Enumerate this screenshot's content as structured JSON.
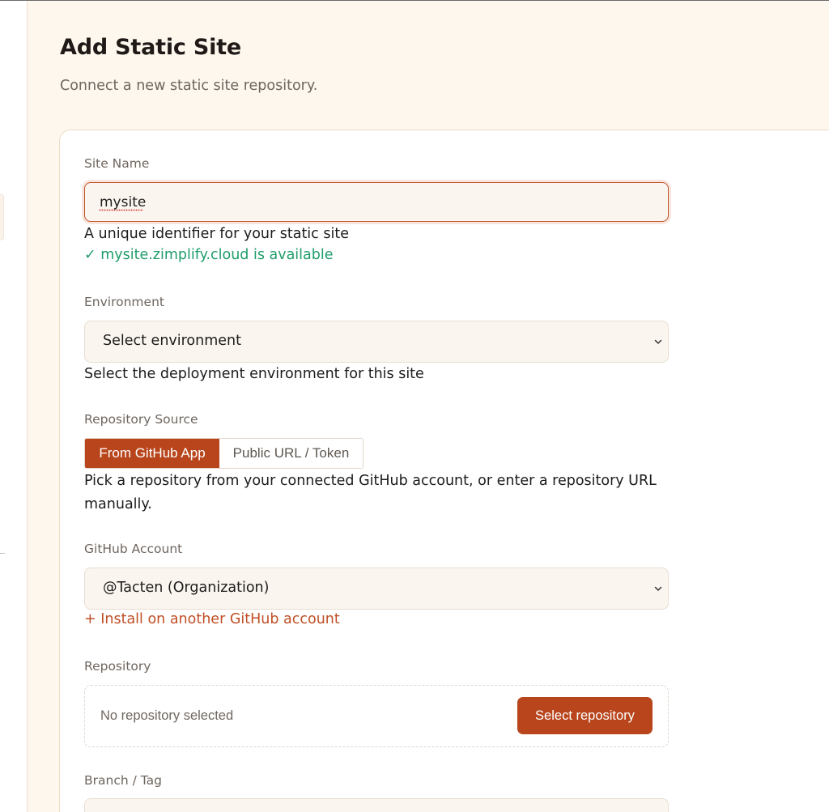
{
  "page": {
    "title": "Add Static Site",
    "subtitle": "Connect a new static site repository."
  },
  "site_name": {
    "label": "Site Name",
    "value": "mysite",
    "help": "A unique identifier for your static site",
    "availability": "✓ mysite.zimplify.cloud is available"
  },
  "environment": {
    "label": "Environment",
    "selected": "Select environment",
    "help": "Select the deployment environment for this site"
  },
  "repository_source": {
    "label": "Repository Source",
    "options": [
      "From GitHub App",
      "Public URL / Token"
    ],
    "selected_index": 0,
    "help": "Pick a repository from your connected GitHub account, or enter a repository URL manually."
  },
  "github_account": {
    "label": "GitHub Account",
    "selected": "@Tacten (Organization)",
    "install_link": "+ Install on another GitHub account"
  },
  "repository": {
    "label": "Repository",
    "empty_text": "No repository selected",
    "button_label": "Select repository"
  },
  "branch": {
    "label": "Branch / Tag"
  },
  "colors": {
    "accent": "#b8451c",
    "success": "#1f9d6b",
    "background": "#fef7ee",
    "field_background": "#fbf5ef"
  },
  "icons": {
    "select_chevron": "chevron-down-icon"
  }
}
